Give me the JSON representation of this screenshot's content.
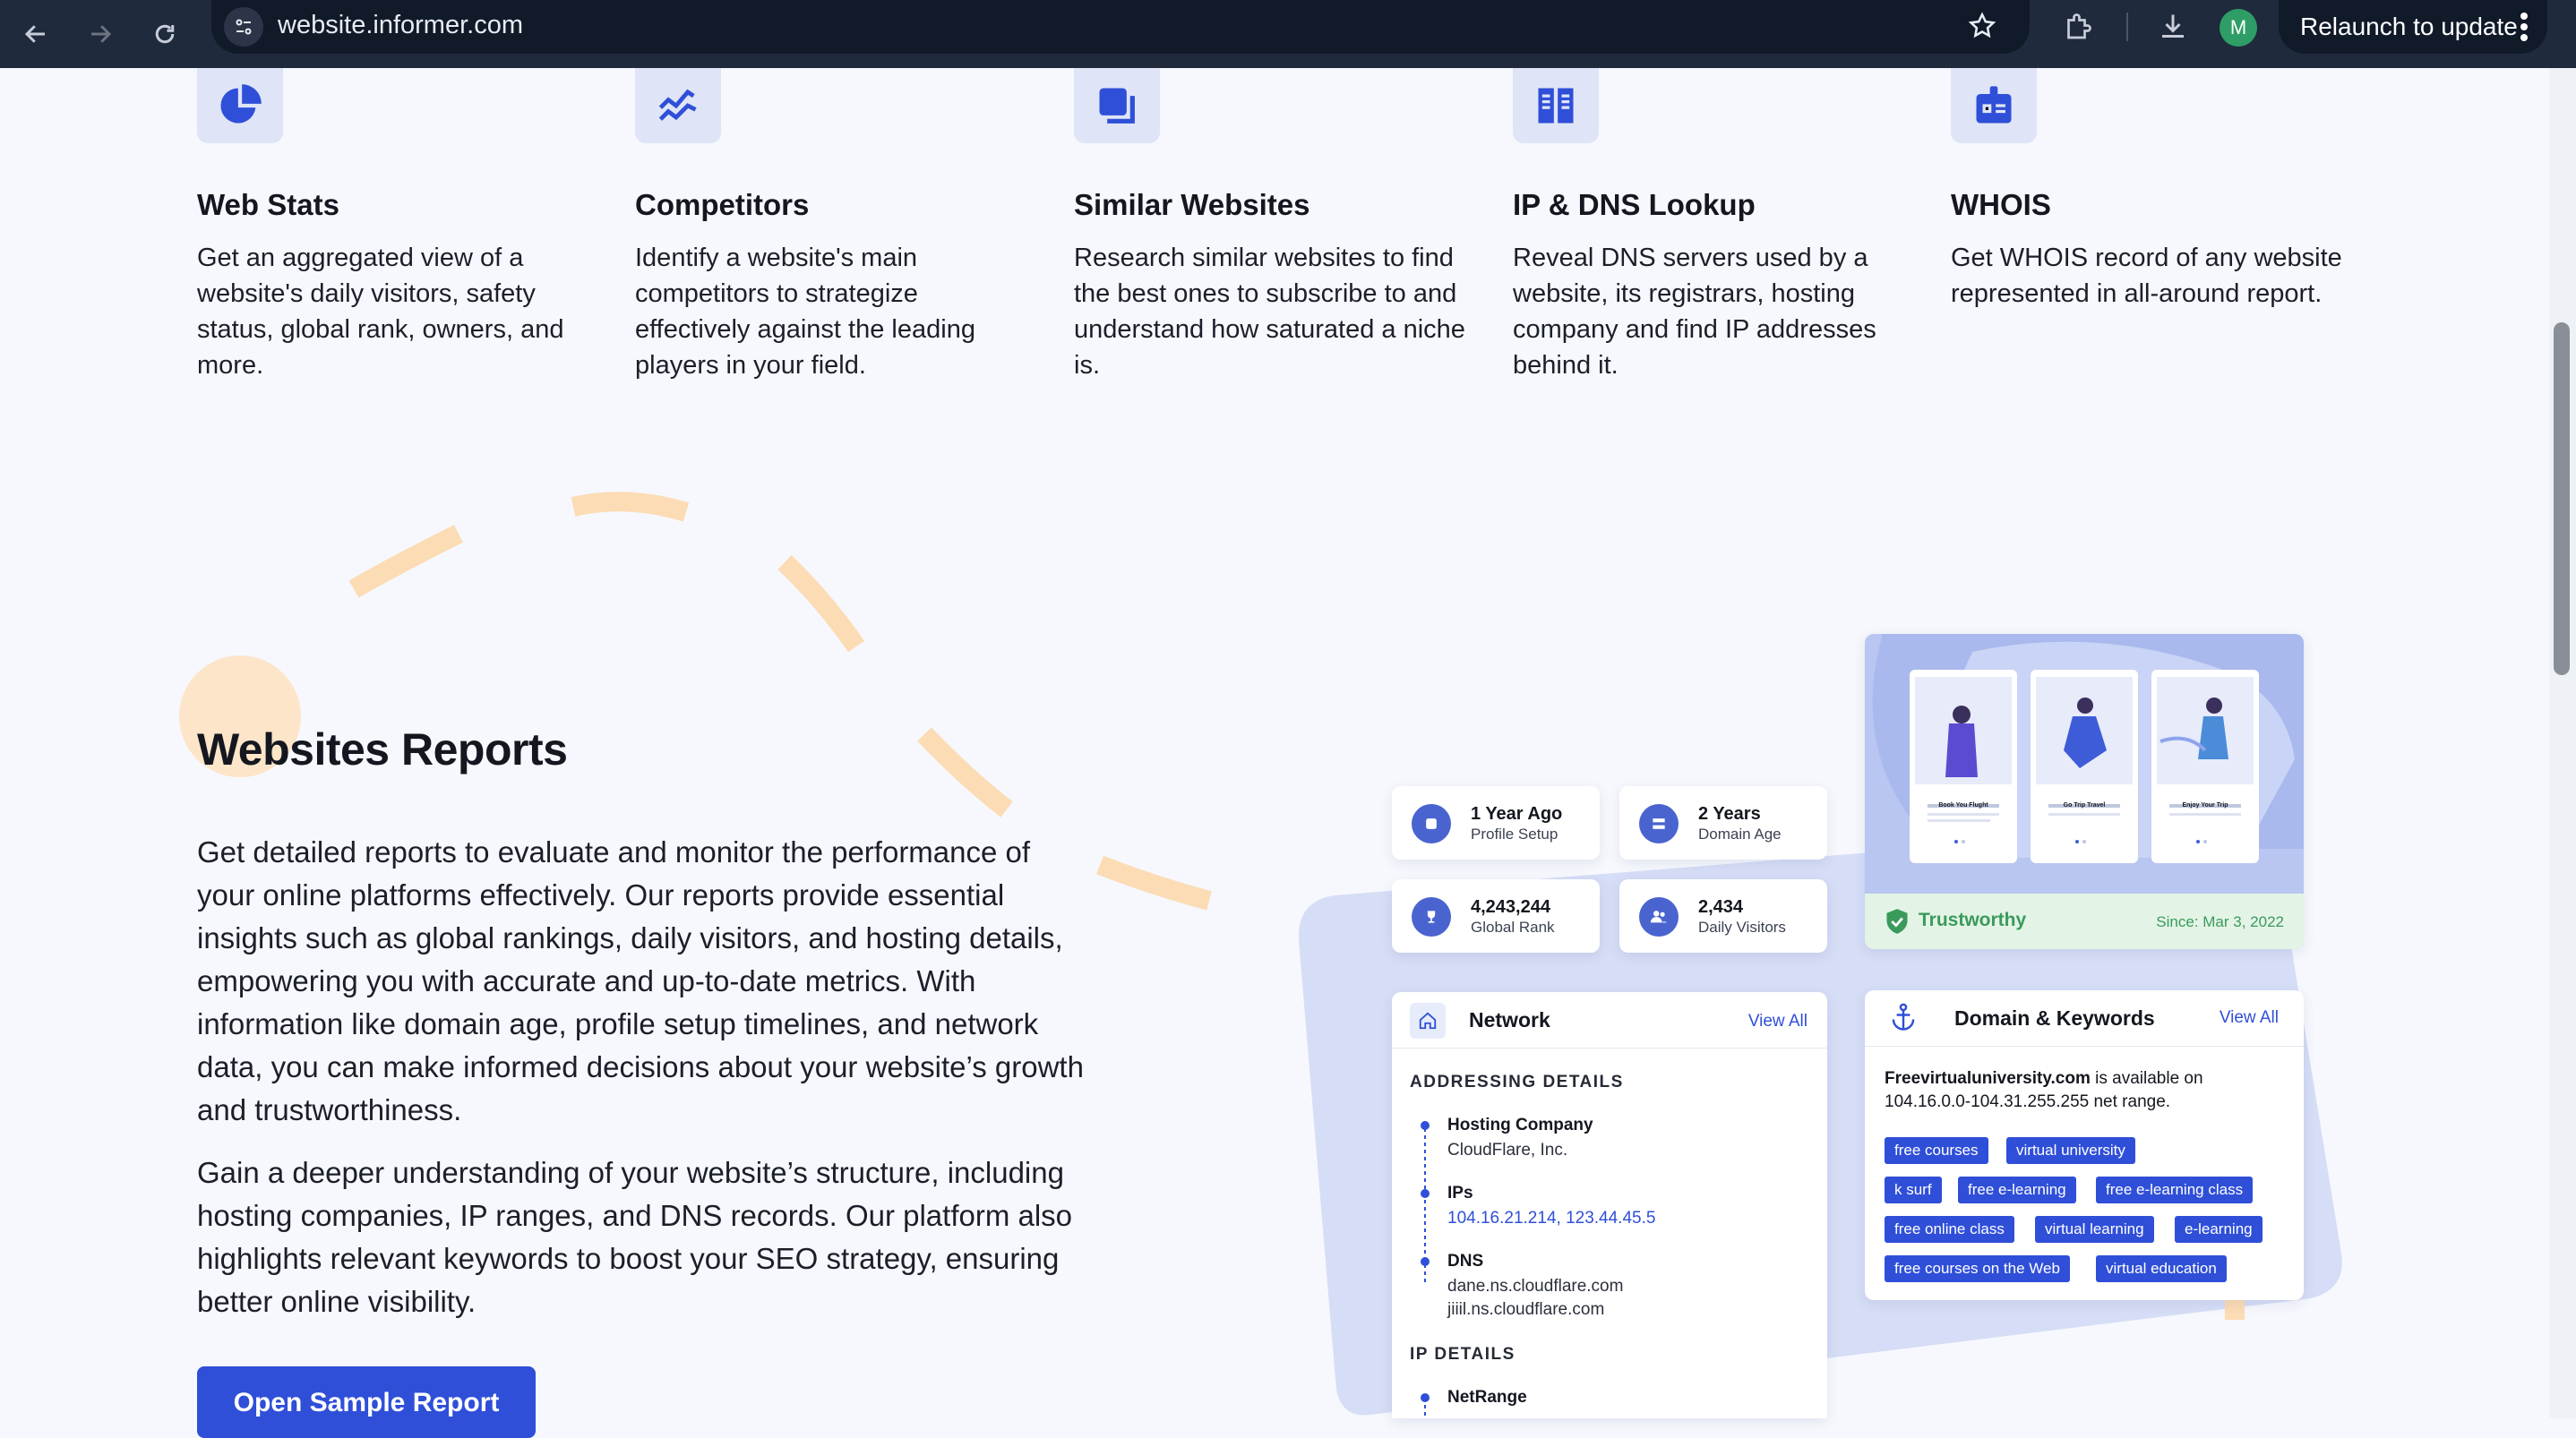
{
  "browser": {
    "url": "website.informer.com",
    "relaunch_label": "Relaunch to update",
    "profile_initial": "M"
  },
  "features": [
    {
      "title": "Web Stats",
      "desc": "Get an aggregated view of a website's daily visitors, safety status, global rank, owners, and more.",
      "icon": "pie-chart-icon"
    },
    {
      "title": "Competitors",
      "desc": "Identify a website's main competitors to strategize effectively against the leading players in your field.",
      "icon": "trend-chart-icon"
    },
    {
      "title": "Similar Websites",
      "desc": "Research similar websites to find the best ones to subscribe to and understand how saturated a niche is.",
      "icon": "copy-icon"
    },
    {
      "title": "IP & DNS Lookup",
      "desc": "Reveal DNS servers used by a website, its registrars, hosting company and find IP addresses behind it.",
      "icon": "columns-icon"
    },
    {
      "title": "WHOIS",
      "desc": "Get WHOIS record of any website represented in all-around report.",
      "icon": "id-badge-icon"
    }
  ],
  "reports": {
    "heading": "Websites Reports",
    "para1": "Get detailed reports to evaluate and monitor the performance of your online platforms effectively. Our reports provide essential insights such as global rankings, daily visitors, and hosting details, empowering you with accurate and up-to-date metrics. With information like domain age, profile setup timelines, and network data, you can make informed decisions about your website’s growth and trustworthiness.",
    "para2": "Gain a deeper understanding of your website’s structure, including hosting companies, IP ranges, and DNS records. Our platform also highlights relevant keywords to boost your SEO strategy, ensuring better online visibility.",
    "button": "Open Sample Report"
  },
  "mockup": {
    "stats": [
      {
        "value": "1 Year Ago",
        "label": "Profile Setup"
      },
      {
        "value": "2 Years",
        "label": "Domain Age"
      },
      {
        "value": "4,243,244",
        "label": "Global Rank"
      },
      {
        "value": "2,434",
        "label": "Daily Visitors"
      }
    ],
    "screens": [
      "Book You Flught",
      "Go Trip Travel",
      "Enjoy Your Trip"
    ],
    "trust": {
      "label": "Trustworthy",
      "since": "Since: Mar 3, 2022"
    },
    "network": {
      "title": "Network",
      "view_all": "View All",
      "addressing_header": "ADDRESSING DETAILS",
      "hosting_label": "Hosting Company",
      "hosting_value": "CloudFlare, Inc.",
      "ips_label": "IPs",
      "ips_value": "104.16.21.214, 123.44.45.5",
      "dns_label": "DNS",
      "dns_1": "dane.ns.cloudflare.com",
      "dns_2": "jiiil.ns.cloudflare.com",
      "ip_header": "IP DETAILS",
      "netrange_label": "NetRange"
    },
    "domain": {
      "title": "Domain & Keywords",
      "view_all": "View All",
      "domain_name": "Freevirtualuniversity.com",
      "avail_text": " is available on",
      "range_text": "104.16.0.0-104.31.255.255 net range.",
      "tags": [
        "free courses",
        "virtual university",
        "k surf",
        "free e-learning",
        "free e-learning class",
        "free online class",
        "virtual learning",
        "e-learning",
        "free courses on the Web",
        "virtual education"
      ]
    }
  },
  "colors": {
    "accent": "#2f4fd8",
    "trust_green": "#3a9a5b",
    "deco_orange": "#fcdcb5"
  }
}
